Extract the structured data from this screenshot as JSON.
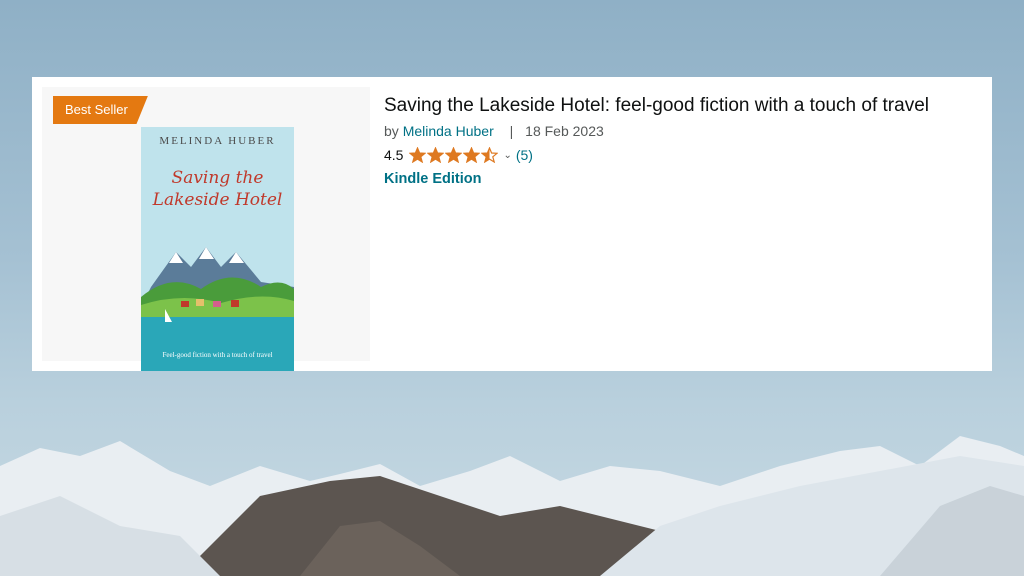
{
  "listing": {
    "badge": "Best Seller",
    "title": "Saving the Lakeside Hotel: feel-good fiction with a touch of travel",
    "by_prefix": "by",
    "author": "Melinda Huber",
    "separator": "|",
    "date": "18 Feb 2023",
    "rating": "4.5",
    "rating_value": 4.5,
    "rating_max": 5,
    "review_count": "(5)",
    "format": "Kindle Edition"
  },
  "cover": {
    "author": "MELINDA HUBER",
    "title_line1": "Saving the",
    "title_line2": "Lakeside Hotel",
    "tagline": "Feel-good fiction with a touch of travel"
  },
  "colors": {
    "badge": "#e47911",
    "link": "#007185",
    "star": "#de7921"
  }
}
